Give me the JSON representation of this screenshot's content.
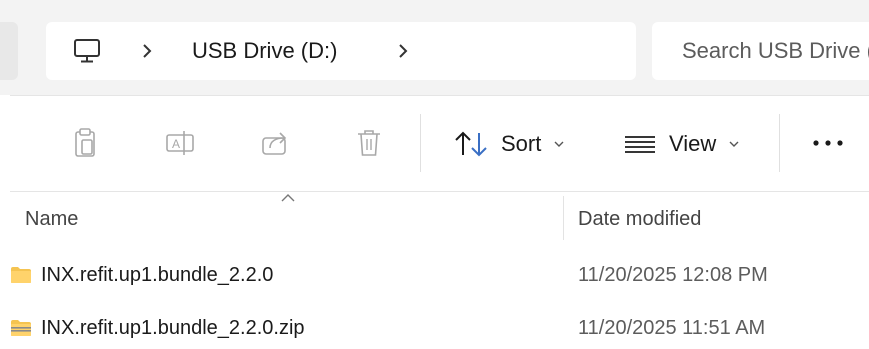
{
  "address_bar": {
    "icon": "computer-icon",
    "breadcrumb": [
      "USB Drive (D:)"
    ],
    "chevron_icon": "chevron-right-icon"
  },
  "search": {
    "placeholder": "Search USB Drive (D:)"
  },
  "toolbar": {
    "icons": [
      "copy-icon",
      "rename-icon",
      "share-icon",
      "delete-icon"
    ],
    "sort_label": "Sort",
    "view_label": "View",
    "more_icon": "more-options-icon"
  },
  "columns": {
    "name": "Name",
    "date_modified": "Date modified",
    "sort_indicator": "sort-ascending-icon"
  },
  "files": [
    {
      "name": "INX.refit.up1.bundle_2.2.0",
      "date_modified": "11/20/2025 12:08 PM",
      "icon": "folder-icon"
    },
    {
      "name": "INX.refit.up1.bundle_2.2.0.zip",
      "date_modified": "11/20/2025 11:51 AM",
      "icon": "zip-folder-icon"
    }
  ],
  "colors": {
    "folder": "#f5c451",
    "zip_stripe": "#8a8a8a",
    "band": "#f3f3f3"
  }
}
